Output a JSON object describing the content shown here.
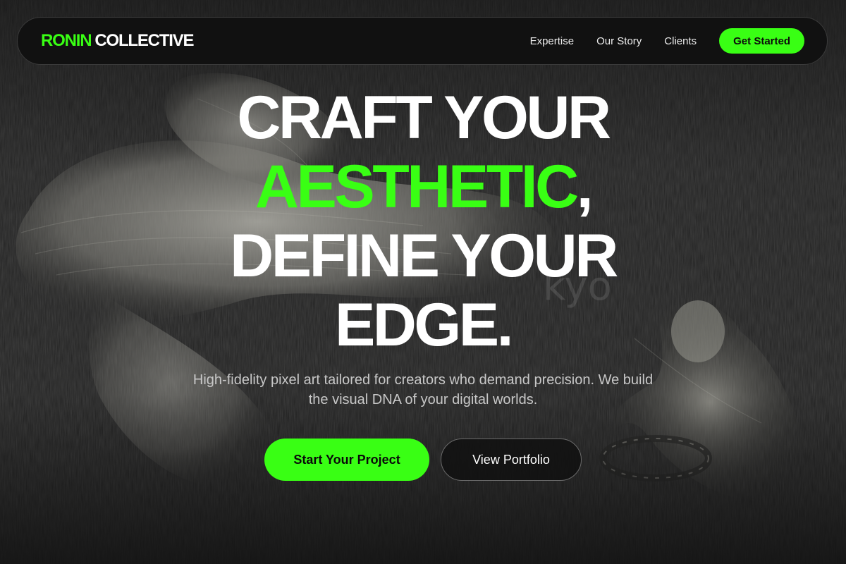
{
  "brand": {
    "name_part1": "RONIN",
    "name_part2": "COLLECTIVE"
  },
  "nav": {
    "links": [
      "Expertise",
      "Our Story",
      "Clients"
    ],
    "cta_label": "Get Started"
  },
  "hero": {
    "title_line1": "CRAFT YOUR",
    "title_accent": "AESTHETIC",
    "title_line2_rest": ",",
    "title_line3": "DEFINE YOUR",
    "title_line4": "EDGE.",
    "subtitle": "High-fidelity pixel art tailored for creators who demand precision. We build the visual DNA of your digital worlds.",
    "primary_button": "Start Your Project",
    "secondary_button": "View Portfolio"
  },
  "colors": {
    "accent": "#39ff14",
    "background": "#1c1c1c",
    "navbar_bg": "#111111",
    "text": "#ffffff"
  }
}
